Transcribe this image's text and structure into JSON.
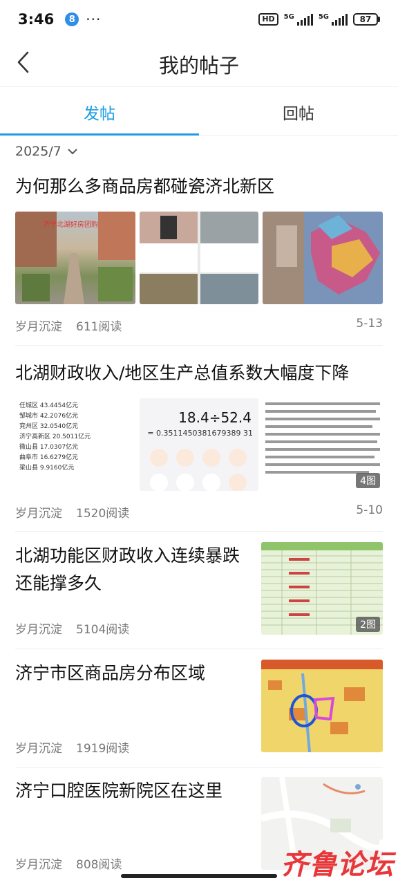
{
  "status": {
    "time": "3:46",
    "notif_badge": "8",
    "more": "···",
    "hd": "HD",
    "sig1": "5G",
    "sig2": "5G",
    "battery": "87"
  },
  "header": {
    "title": "我的帖子"
  },
  "tabs": [
    {
      "label": "发帖",
      "active": true
    },
    {
      "label": "回帖",
      "active": false
    }
  ],
  "filter": {
    "month": "2025/7"
  },
  "posts": [
    {
      "title": "为何那么多商品房都碰瓷济北新区",
      "author": "岁月沉淀",
      "reads": "611阅读",
      "date": "5-13",
      "image_badge": ""
    },
    {
      "title": "北湖财政收入/地区生产总值系数大幅度下降",
      "author": "岁月沉淀",
      "reads": "1520阅读",
      "date": "5-10",
      "image_badge": "4图",
      "calc": {
        "expr": "18.4÷52.4",
        "result": "= 0.3511450381679389 31"
      },
      "list_items": [
        "任城区  43.4454亿元",
        "邹城市  42.2076亿元",
        "兖州区  32.0540亿元",
        "济宁高新区  20.5011亿元",
        "微山县  17.0307亿元",
        "曲阜市  16.6279亿元",
        "梁山县  9.9160亿元"
      ]
    },
    {
      "title_line1": "北湖功能区财政收入连续暴跌",
      "title_line2": "还能撑多久",
      "author": "岁月沉淀",
      "reads": "5104阅读",
      "date": "",
      "image_badge": "2图"
    },
    {
      "title": "济宁市区商品房分布区域",
      "author": "岁月沉淀",
      "reads": "1919阅读",
      "date": ""
    },
    {
      "title": "济宁口腔医院新院区在这里",
      "author": "岁月沉淀",
      "reads": "808阅读",
      "date": ""
    }
  ],
  "watermark": "齐鲁论坛",
  "colors": {
    "accent": "#1b9ce4",
    "watermark": "#e8363a"
  }
}
